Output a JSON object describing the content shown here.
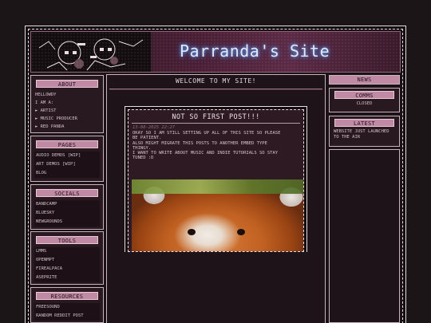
{
  "header": {
    "site_title": "Parranda's Site"
  },
  "sidebar": {
    "about": {
      "title": "ABOUT",
      "lines": [
        "HELLOWDY",
        "I AM A:"
      ],
      "items": [
        "► ARTIST",
        "► MUSIC PRODUCER",
        "► RED PANDA"
      ]
    },
    "pages": {
      "title": "PAGES",
      "links": [
        "AUDIO DEMOS [WIP]",
        "ART DEMOS [WIP]",
        "BLOG"
      ]
    },
    "socials": {
      "title": "SOCIALS",
      "links": [
        "BANDCAMP",
        "BLUESKY",
        "NEWGROUNDS"
      ]
    },
    "tools": {
      "title": "TOOLS",
      "links": [
        "LMMS",
        "OPENMPT",
        "FIREALPACA",
        "ASEPRITE"
      ]
    },
    "resources": {
      "title": "RESOURCES",
      "links": [
        "FREESOUND",
        "RANDOM REDDIT POST"
      ]
    }
  },
  "main": {
    "welcome": "WELCOME TO MY SITE!",
    "post": {
      "title": "NOT SO FIRST POST!!!",
      "date": "13-08-2025 22:27",
      "lines": [
        "OKAY SO I AM STILL SETTING UP ALL OF THIS SITE SO PLEASE",
        "BE PATIENT.",
        "ALSO MIGHT MIGRATE THIS POSTS TO ANOTHER EMBED TYPE",
        "THINGY.",
        "I WANT TO WRITE ABOUT MUSIC AND INDIE TUTORIALS SO STAY",
        "TUNED :D"
      ],
      "image_subject": "red-panda-photo"
    }
  },
  "right": {
    "news": {
      "title": "NEWS"
    },
    "comms": {
      "title": "COMMS",
      "status": "CLOSED"
    },
    "latest": {
      "title": "LATEST",
      "text": "WEBSITE JUST LAUNCHED TO THE AIR"
    }
  },
  "colors": {
    "accent_pink": "#c089a4",
    "title_glow": "#6aa6ff",
    "background": "#1b1517"
  }
}
